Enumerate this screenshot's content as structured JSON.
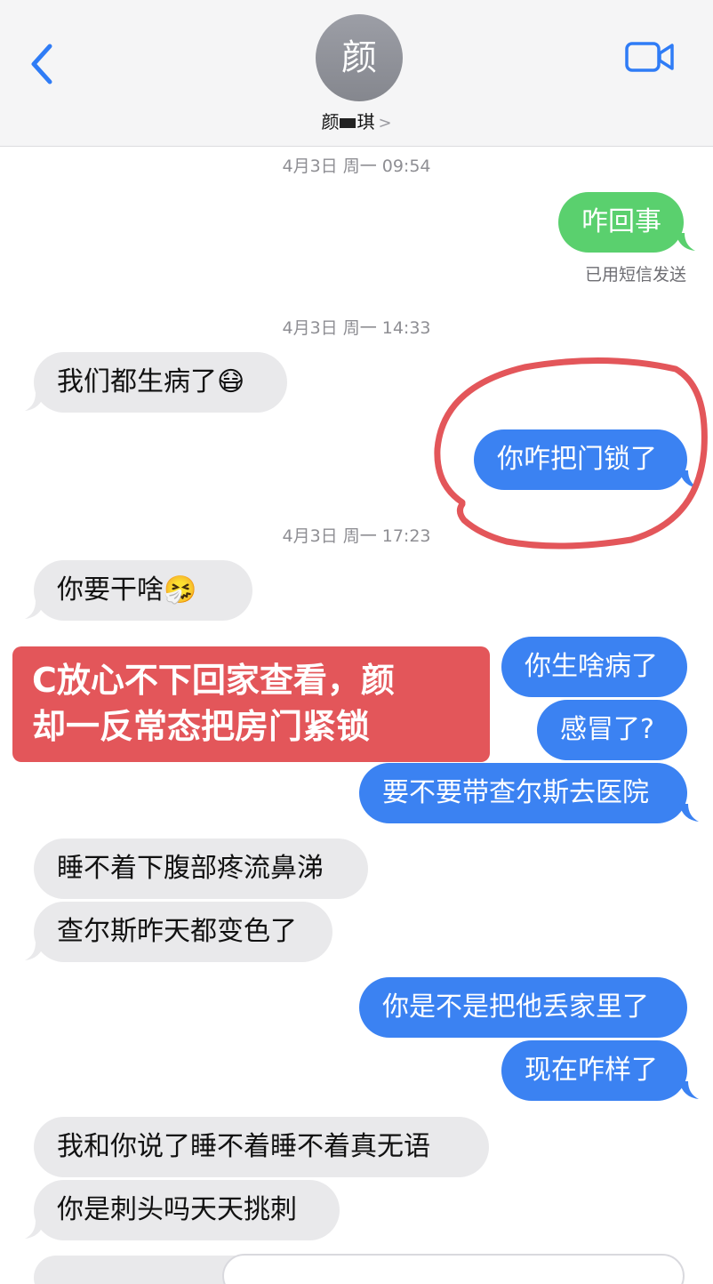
{
  "header": {
    "avatar_initial": "颜",
    "contact_name_a": "颜",
    "contact_name_b": "琪",
    "contact_chevron": ">",
    "back_icon": "chevron-left-icon",
    "video_icon": "video-camera-icon",
    "accent_color": "#3b82f2"
  },
  "conversation": {
    "timestamps": [
      "4月3日 周一 09:54",
      "4月3日 周一 14:33",
      "4月3日 周一 17:23"
    ],
    "sms_status": "已用短信发送",
    "messages": {
      "m1": "咋回事",
      "m2": "我们都生病了😷",
      "m3": "你咋把门锁了",
      "m4": "你要干啥🤧",
      "m5": "你生啥病了",
      "m6": "感冒了?",
      "m7": "要不要带查尔斯去医院",
      "m8": "睡不着下腹部疼流鼻涕",
      "m9": "查尔斯昨天都变色了",
      "m10": "你是不是把他丢家里了",
      "m11": "现在咋样了",
      "m12": "我和你说了睡不着睡不着真无语",
      "m13": "你是刺头吗天天挑刺"
    }
  },
  "annotation": {
    "line1": "C放心不下回家查看，颜",
    "line2": "却一反常态把房门紧锁",
    "color": "#e3565a"
  }
}
